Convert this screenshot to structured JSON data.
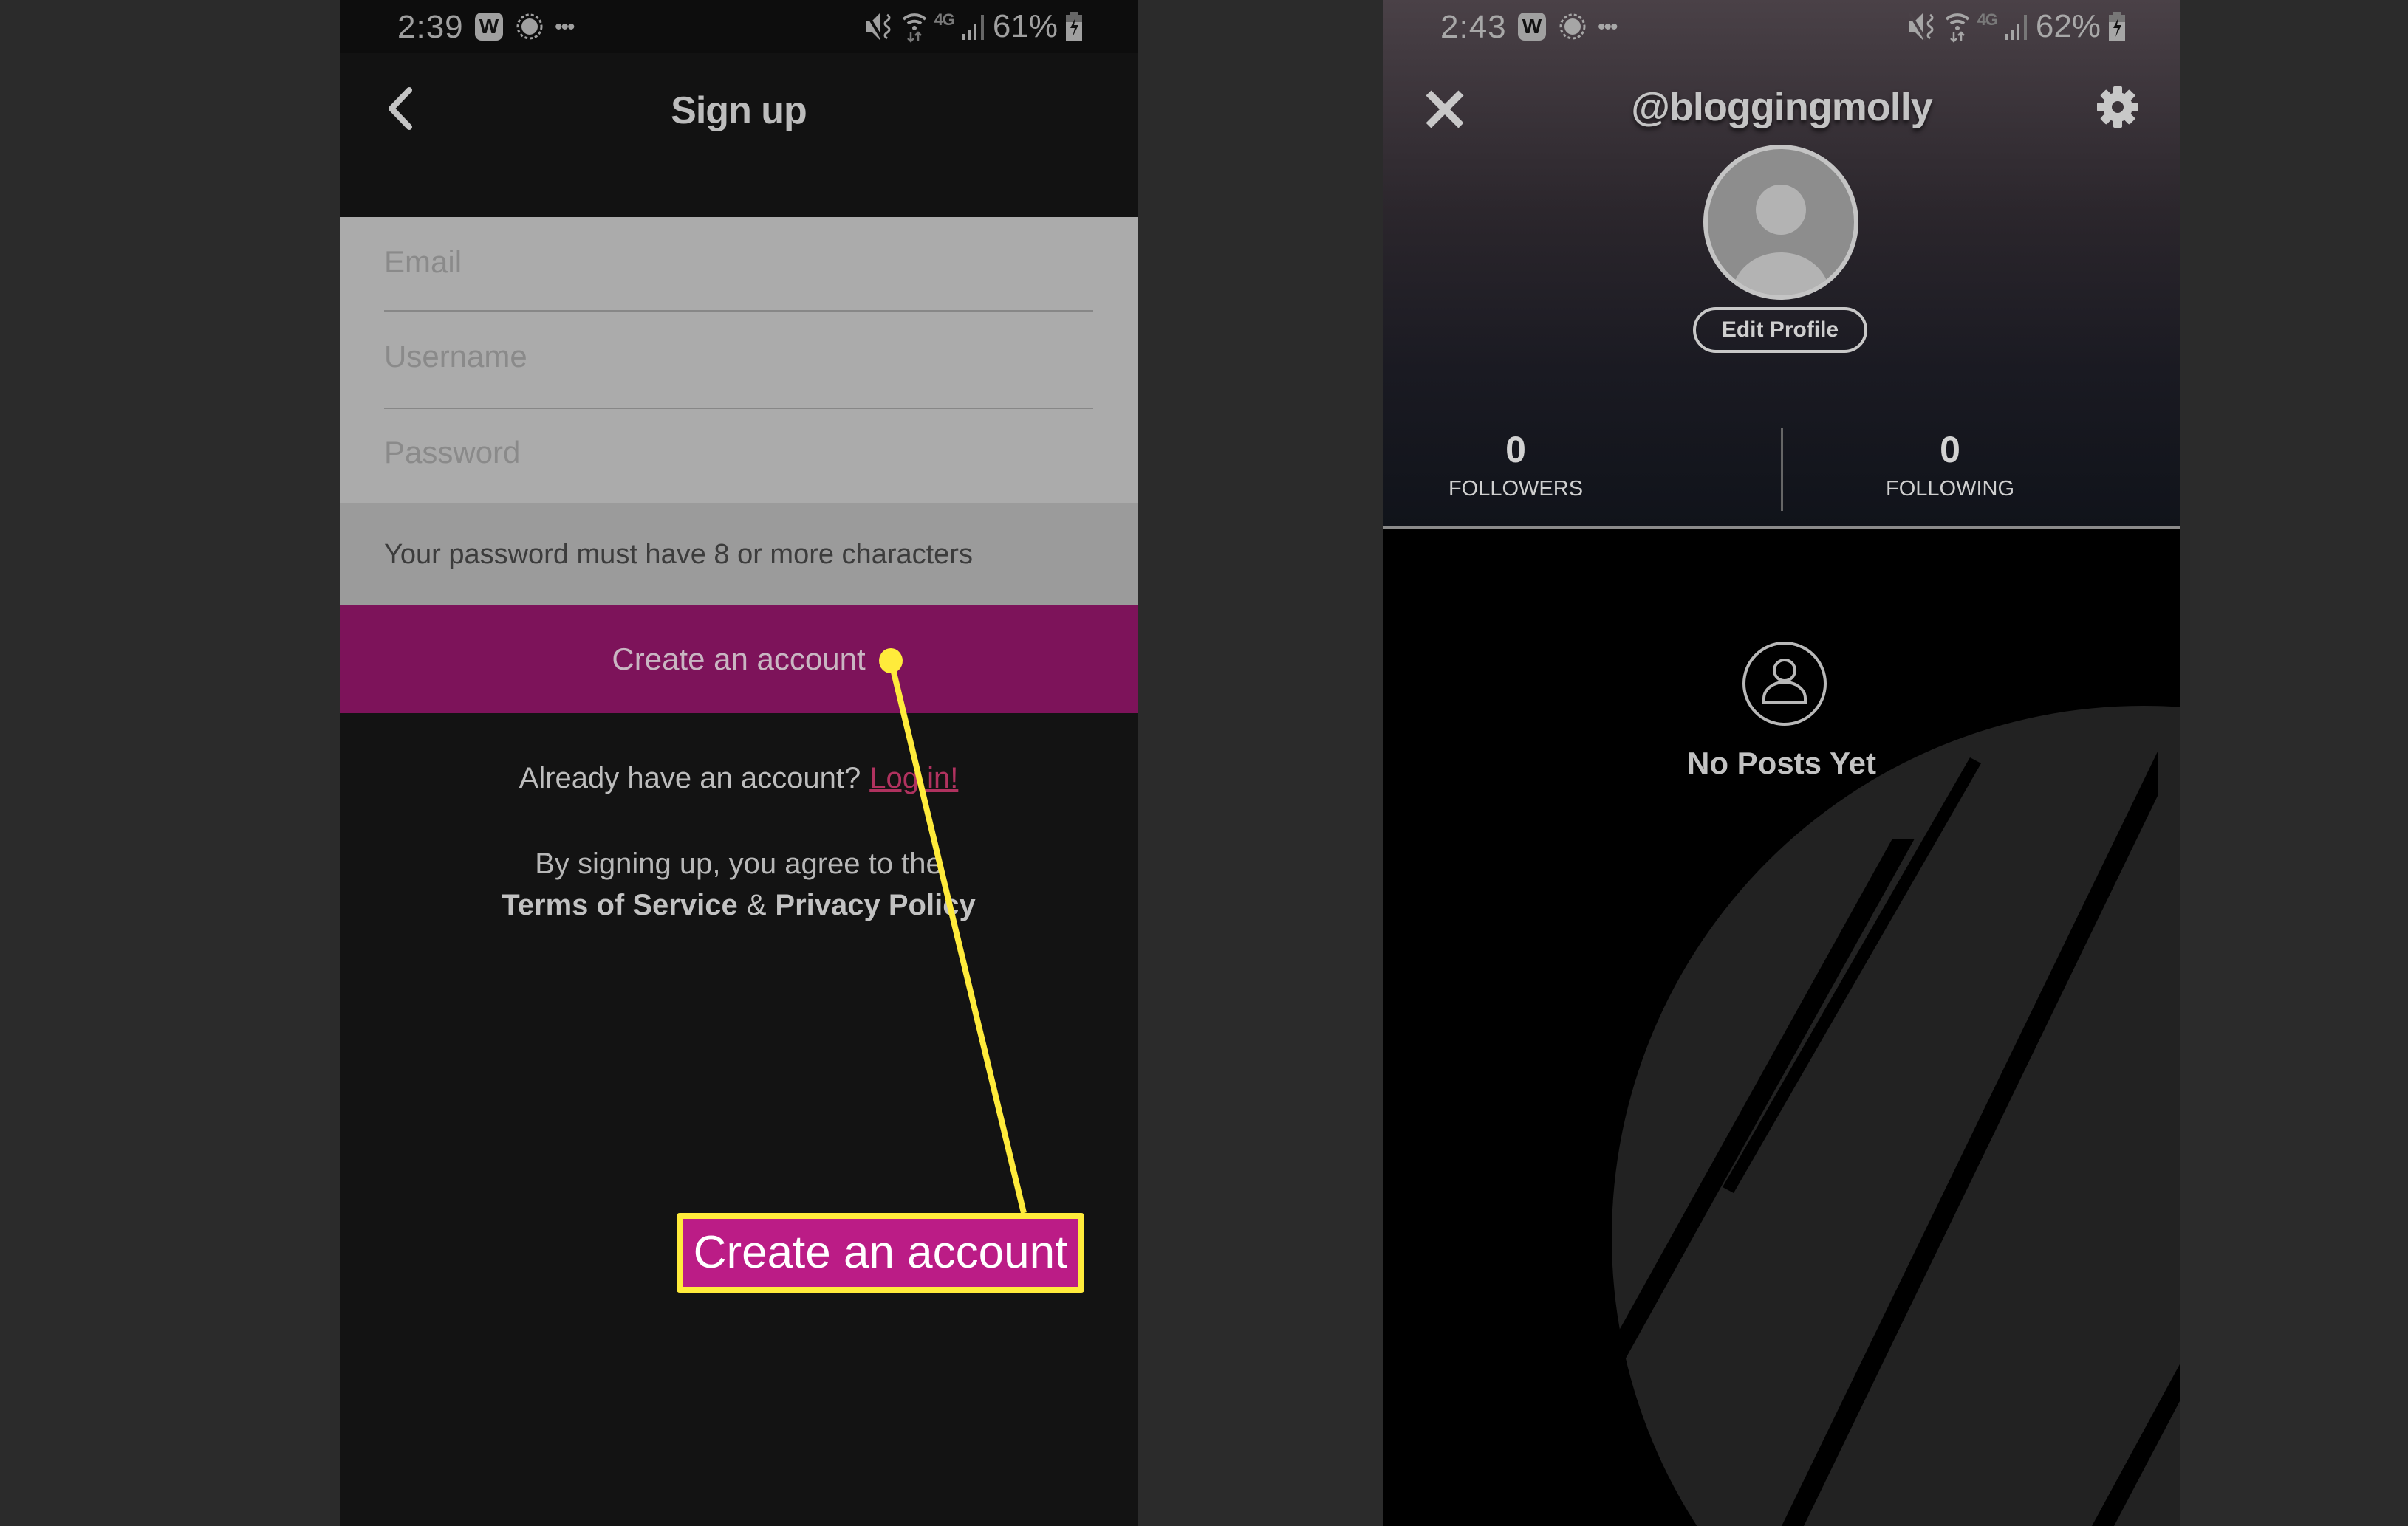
{
  "left_screen": {
    "status_bar": {
      "time": "2:39",
      "notification_icons": [
        "w-app-icon",
        "sun-icon",
        "more-dots-icon"
      ],
      "system_icons": [
        "mute-vibrate-icon",
        "wifi-icon",
        "4g-lte-icon",
        "signal-icon",
        "battery-charging-icon"
      ],
      "network_label": "4G",
      "battery": "61%"
    },
    "header": {
      "title": "Sign up",
      "back_icon": "chevron-left-icon"
    },
    "form": {
      "email": {
        "placeholder": "Email",
        "value": ""
      },
      "username": {
        "placeholder": "Username",
        "value": ""
      },
      "password": {
        "placeholder": "Password",
        "value": ""
      },
      "hint": "Your password must have 8 or more characters",
      "submit_label": "Create an account"
    },
    "login_prompt": {
      "text": "Already have an account?",
      "link_label": "Log in!"
    },
    "legal": {
      "intro": "By signing up, you agree to the",
      "terms_label": "Terms of Service",
      "separator": "&",
      "privacy_label": "Privacy Policy"
    }
  },
  "annotation": {
    "callout_label": "Create an account",
    "color": "#ffeb3b",
    "fill": "#bb1c86"
  },
  "right_screen": {
    "status_bar": {
      "time": "2:43",
      "notification_icons": [
        "w-app-icon",
        "sun-icon",
        "more-dots-icon"
      ],
      "system_icons": [
        "mute-vibrate-icon",
        "wifi-icon",
        "4g-lte-icon",
        "signal-icon",
        "battery-charging-icon"
      ],
      "network_label": "4G",
      "battery": "62%"
    },
    "header": {
      "username": "@bloggingmolly",
      "close_icon": "close-icon",
      "settings_icon": "gear-icon",
      "edit_profile_label": "Edit Profile"
    },
    "stats": [
      {
        "value": "0",
        "label": "FOLLOWERS"
      },
      {
        "value": "0",
        "label": "FOLLOWING"
      }
    ],
    "empty_state": {
      "icon": "user-circle-icon",
      "text": "No Posts Yet"
    }
  },
  "colors": {
    "brand_purple": "#7d135a",
    "link_pink": "#b0325f",
    "annotation_yellow": "#ffeb3b"
  }
}
